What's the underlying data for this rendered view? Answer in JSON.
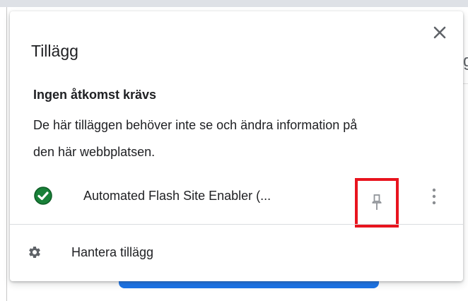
{
  "popup": {
    "title": "Tillägg",
    "close_icon": "close-icon"
  },
  "section": {
    "heading": "Ingen åtkomst krävs",
    "description": "De här tilläggen behöver inte se och ändra information på den här webbplatsen."
  },
  "extension": {
    "name": "Automated Flash Site Enabler (...",
    "status_icon": "check-circle-icon",
    "status_color": "#188038",
    "pin_icon": "pin-icon",
    "more_icon": "more-vert-icon"
  },
  "manage": {
    "label": "Hantera tillägg",
    "icon": "gear-icon"
  },
  "highlight_color": "#e8141e"
}
